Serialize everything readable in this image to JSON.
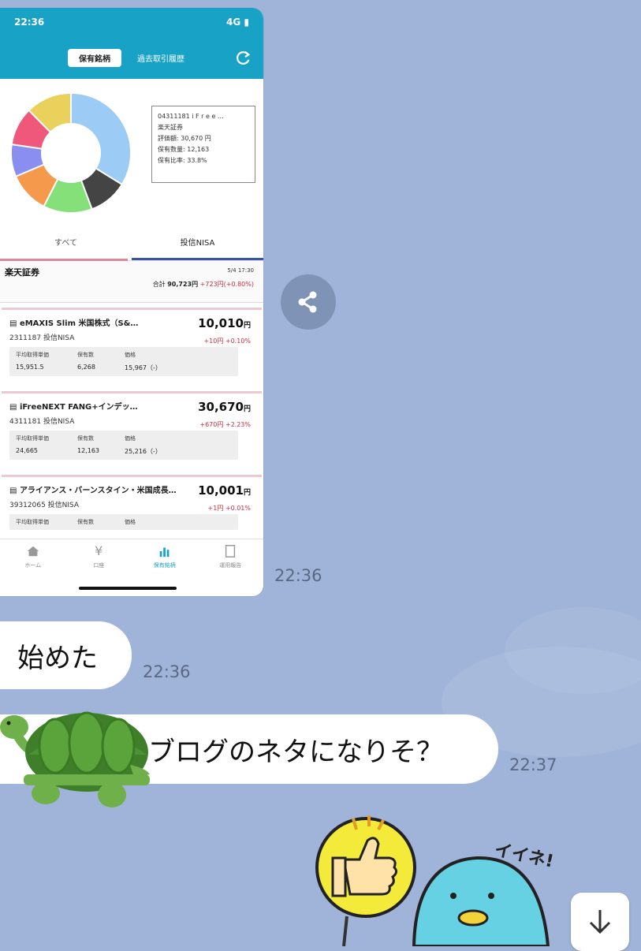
{
  "chat": {
    "messages": [
      {
        "type": "image",
        "time": "22:36"
      },
      {
        "type": "text",
        "text": "始めた",
        "time": "22:36"
      },
      {
        "type": "text",
        "text": "ンブログのネタになりそ？",
        "time": "22:37"
      }
    ],
    "sticker_text": "イイネ!"
  },
  "screenshot": {
    "status_time": "22:36",
    "status_network": "4G",
    "tabs": [
      "保有銘柄",
      "過去取引履歴"
    ],
    "tooltip": {
      "line1": "04311181 i F r e e ...",
      "line2": "楽天証券",
      "line3": "評価額: 30,670 円",
      "line4": "保有数量: 12,163",
      "line5": "保有比率: 33.8%"
    },
    "segments": [
      "すべて",
      "投信NISA"
    ],
    "broker": {
      "name": "楽天証券",
      "date": "5/4 17:30",
      "total_label": "合計",
      "total_value": "90,723円",
      "total_change": "+723円(+0.80%)"
    },
    "funds": [
      {
        "title": "eMAXIS Slim 米国株式（S&…",
        "price": "10,010",
        "unit": "円",
        "code": "2311187 投信NISA",
        "change": "+10円 +0.10%",
        "headers": [
          "平均取得単価",
          "保有数",
          "価格"
        ],
        "values": [
          "15,951.5",
          "6,268",
          "15,967（-）"
        ]
      },
      {
        "title": "iFreeNEXT FANG+インデッ…",
        "price": "30,670",
        "unit": "円",
        "code": "4311181 投信NISA",
        "change": "+670円 +2.23%",
        "headers": [
          "平均取得単価",
          "保有数",
          "価格"
        ],
        "values": [
          "24,665",
          "12,163",
          "25,216（-）"
        ]
      },
      {
        "title": "アライアンス・バーンスタイン・米国成長…",
        "price": "10,001",
        "unit": "円",
        "code": "39312065 投信NISA",
        "change": "+1円 +0.01%",
        "headers": [
          "平均取得単価",
          "保有数",
          "価格"
        ],
        "values": [
          "",
          "",
          ""
        ]
      }
    ],
    "nav": [
      "ホーム",
      "口座",
      "保有銘柄",
      "運用報告"
    ]
  },
  "chart_data": {
    "type": "pie",
    "values": [
      33.8,
      10.5,
      13.2,
      11.1,
      8.7,
      10.3,
      12.4
    ],
    "colors": [
      "#9ccbf5",
      "#444444",
      "#86e07a",
      "#f59a4c",
      "#8a8ef0",
      "#f0587b",
      "#e9d15c"
    ]
  }
}
